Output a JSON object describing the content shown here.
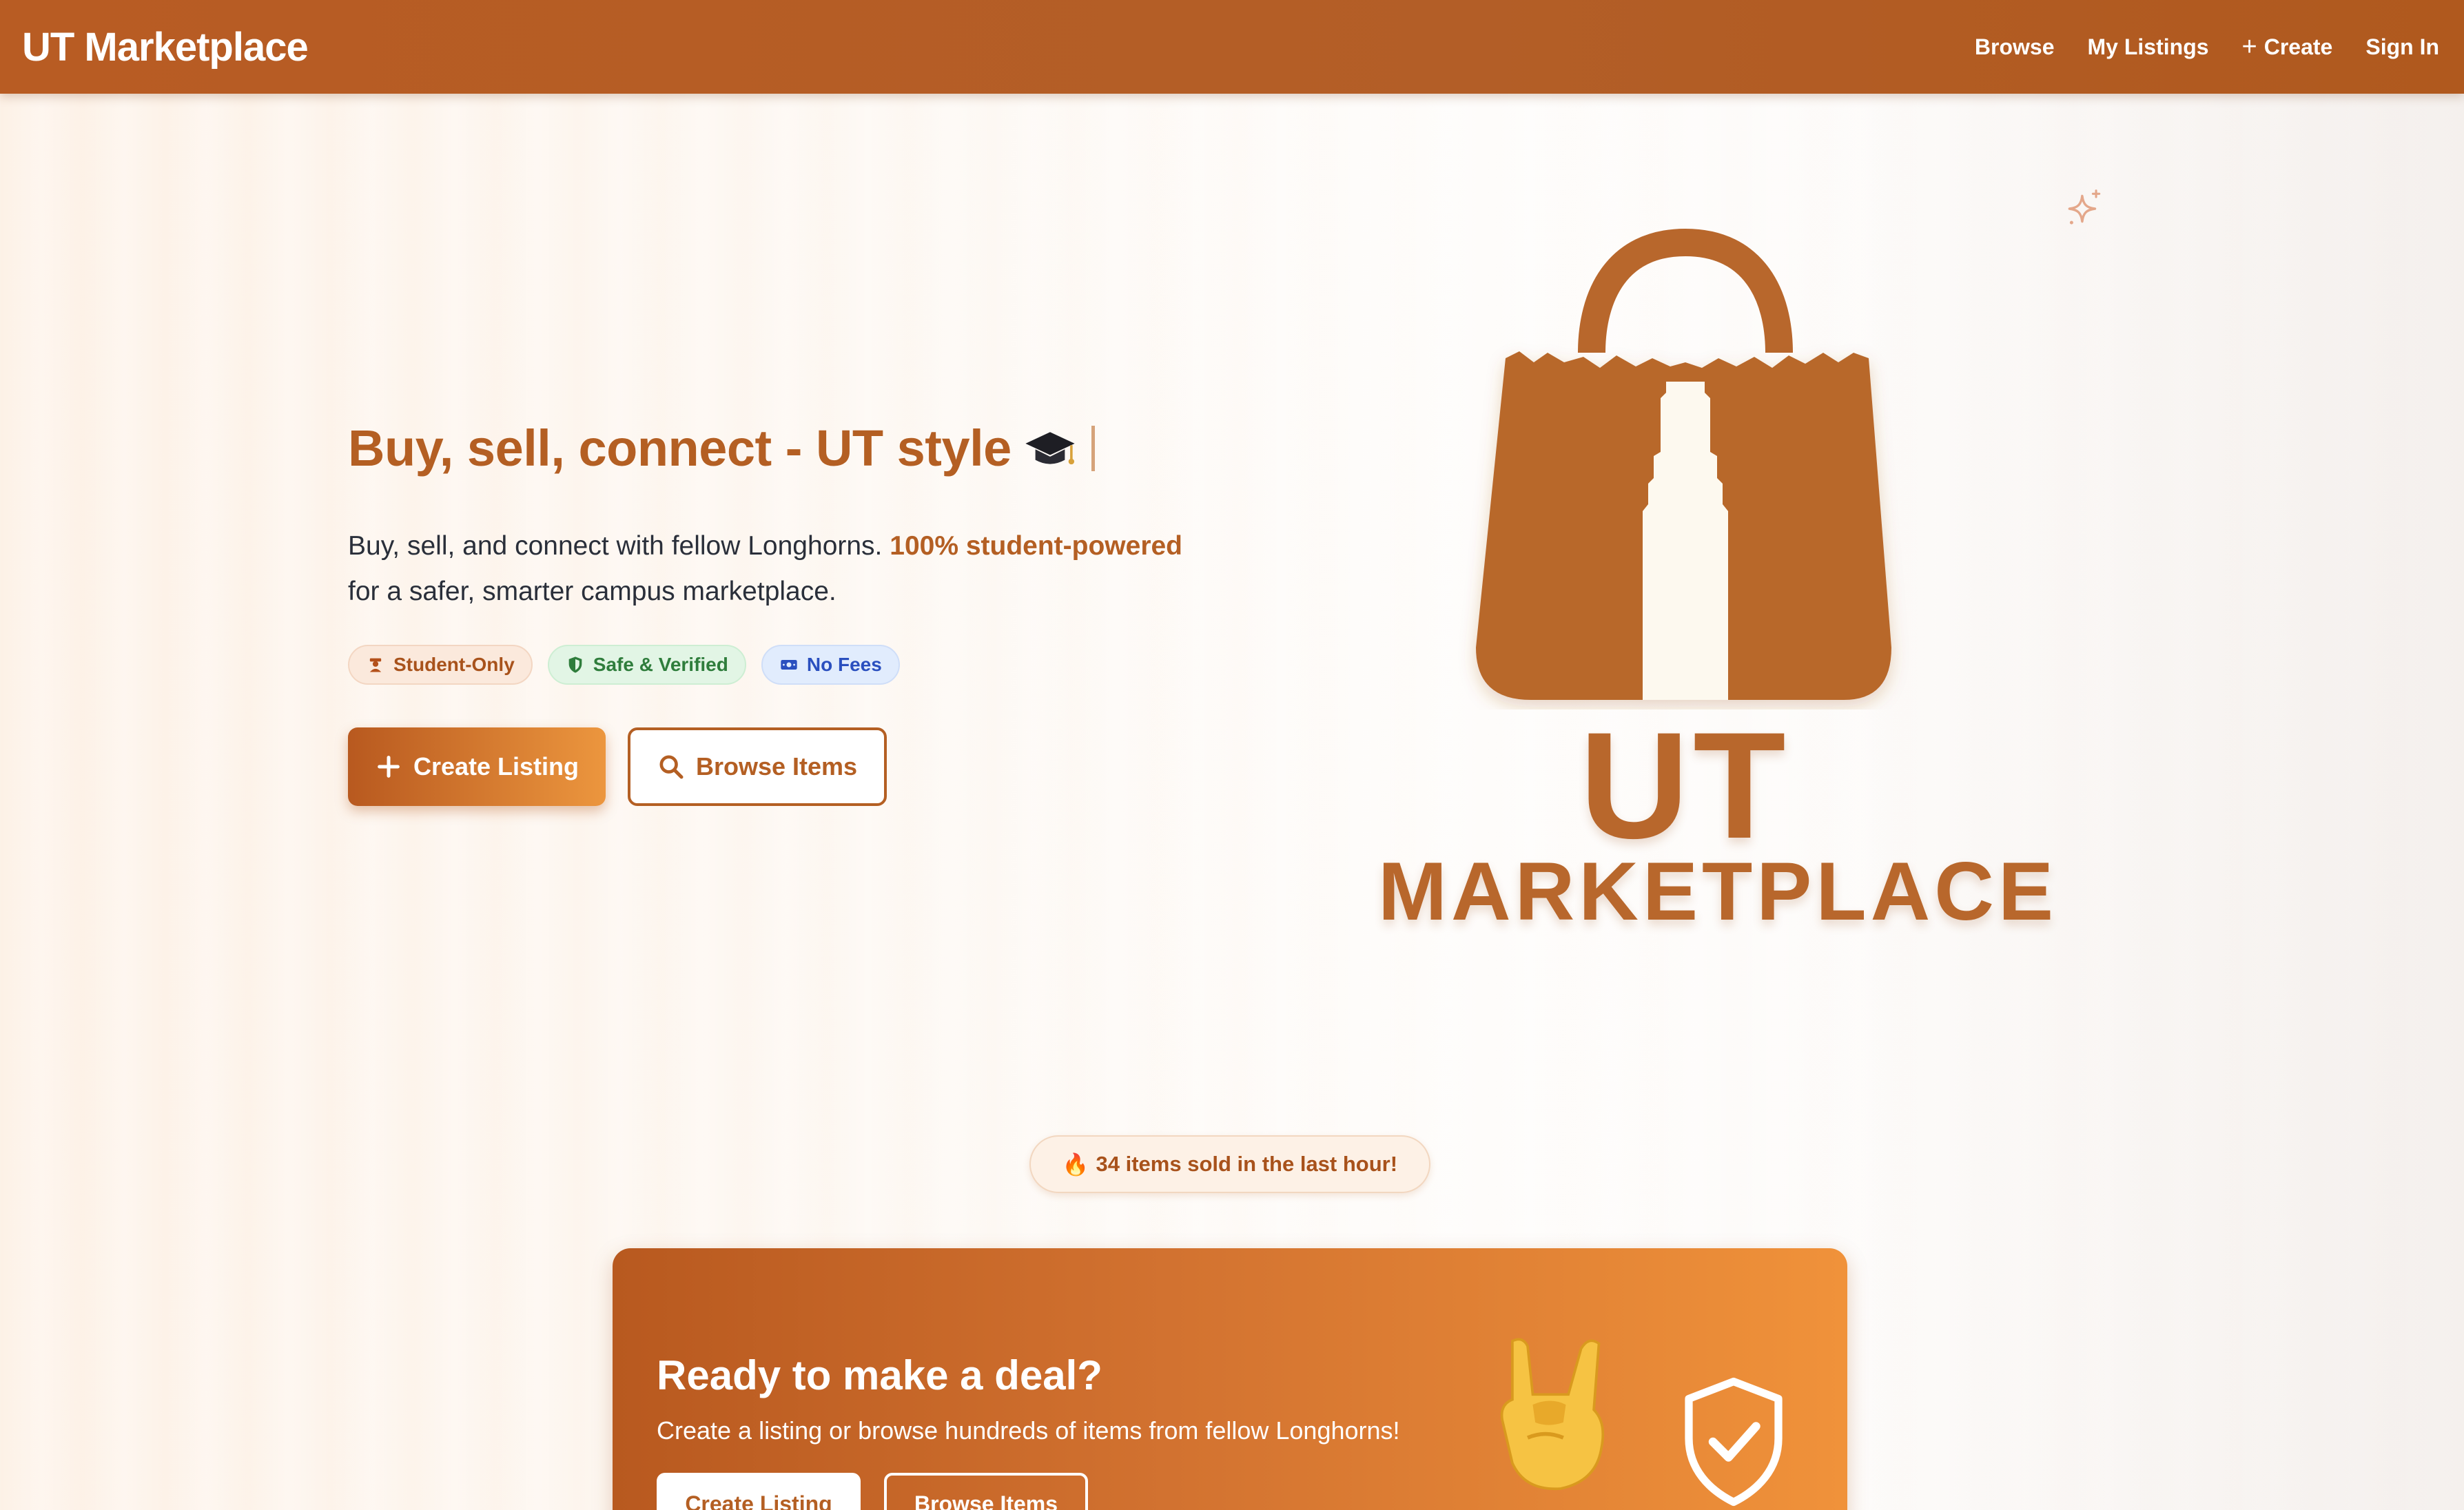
{
  "nav": {
    "brand": "UT Marketplace",
    "links": [
      "Browse",
      "My Listings",
      "Create",
      "Sign In"
    ]
  },
  "hero": {
    "title": "Buy, sell, connect - UT style",
    "title_icon": "graduation-cap-icon",
    "description_plain": "Buy, sell, and connect with fellow Longhorns.",
    "description_highlight": "100% student-powered",
    "description_line2": "for a safer, smarter campus marketplace.",
    "badges": [
      {
        "label": "Student-Only",
        "icon": "student-icon"
      },
      {
        "label": "Safe & Verified",
        "icon": "shield-icon"
      },
      {
        "label": "No Fees",
        "icon": "money-icon"
      }
    ],
    "primary_button": "Create Listing",
    "secondary_button": "Browse Items"
  },
  "logo": {
    "line1": "UT",
    "line2": "MARKETPLACE"
  },
  "activity": {
    "emoji": "🔥",
    "text": "34 items sold in the last hour!"
  },
  "cta": {
    "title": "Ready to make a deal?",
    "subtitle": "Create a listing or browse hundreds of items from fellow Longhorns!",
    "primary_button": "Create Listing",
    "secondary_button": "Browse Items"
  },
  "colors": {
    "brand": "#b45f23",
    "accent": "#ec963e",
    "green": "#2f7d3c",
    "blue": "#2a4fbf"
  }
}
